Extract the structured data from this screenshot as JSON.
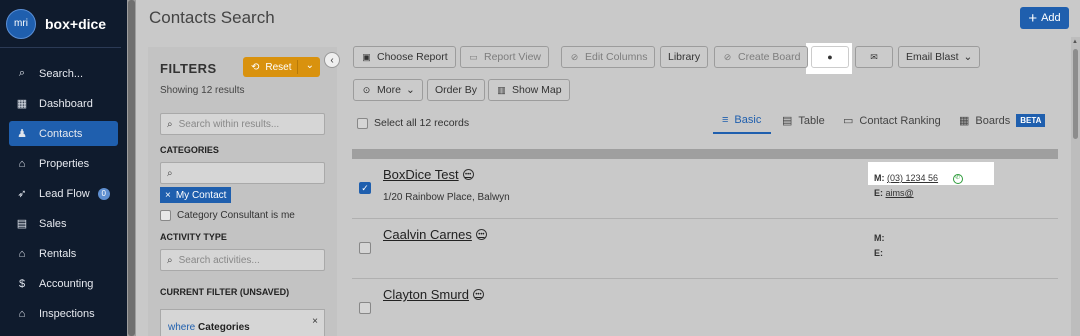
{
  "brand": {
    "logo_text": "mri",
    "name": "box+dice"
  },
  "sidebar": {
    "items": [
      {
        "label": "Search...",
        "icon": "search-icon",
        "glyph": "🔍",
        "active": false
      },
      {
        "label": "Dashboard",
        "icon": "dashboard-icon",
        "glyph": "▦",
        "active": false
      },
      {
        "label": "Contacts",
        "icon": "contacts-icon",
        "glyph": "👤",
        "active": true
      },
      {
        "label": "Properties",
        "icon": "home-icon",
        "glyph": "⌂",
        "active": false
      },
      {
        "label": "Lead Flow",
        "icon": "lead-flow-icon",
        "glyph": "➶",
        "active": false,
        "badge": "0"
      },
      {
        "label": "Sales",
        "icon": "sales-icon",
        "glyph": "▤",
        "active": false
      },
      {
        "label": "Rentals",
        "icon": "rentals-icon",
        "glyph": "⌂",
        "active": false
      },
      {
        "label": "Accounting",
        "icon": "accounting-icon",
        "glyph": "$",
        "active": false
      },
      {
        "label": "Inspections",
        "icon": "inspections-icon",
        "glyph": "⌂",
        "active": false
      }
    ]
  },
  "header": {
    "title": "Contacts Search",
    "add_label": "Add"
  },
  "filters": {
    "title": "FILTERS",
    "showing": "Showing 12 results",
    "reset_label": "Reset",
    "search_placeholder": "Search within results...",
    "categories_label": "CATEGORIES",
    "category_chip": "My Contact",
    "consultant_checkbox": "Category Consultant is me",
    "activity_label": "ACTIVITY TYPE",
    "activity_placeholder": "Search activities...",
    "current_filter_label": "CURRENT FILTER (UNSAVED)",
    "current_filter_where": "where",
    "current_filter_field": "Categories"
  },
  "toolbar": {
    "choose_report": "Choose Report",
    "report_view": "Report View",
    "edit_columns": "Edit Columns",
    "library": "Library",
    "create_board": "Create Board",
    "email_blast": "Email Blast",
    "more": "More",
    "order_by": "Order By",
    "show_map": "Show Map"
  },
  "views": {
    "select_all": "Select all 12 records",
    "tabs": [
      "Basic",
      "Table",
      "Contact Ranking",
      "Boards"
    ],
    "beta": "BETA"
  },
  "contacts": [
    {
      "name": "BoxDice Test",
      "address": "1/20 Rainbow Place, Balwyn",
      "mobile_label": "M:",
      "mobile": "(03) 1234 56",
      "email_label": "E:",
      "email": "aims@",
      "checked": true
    },
    {
      "name": "Caalvin Carnes",
      "address": "",
      "mobile_label": "M:",
      "mobile": "",
      "email_label": "E:",
      "email": "",
      "checked": false
    },
    {
      "name": "Clayton Smurd",
      "address": "",
      "mobile_label": "",
      "mobile": "",
      "email_label": "",
      "email": "",
      "checked": false
    }
  ],
  "colors": {
    "brand_blue": "#1f5fae",
    "sidebar_bg": "#0f1b2d",
    "reset_orange": "#d9920e"
  }
}
